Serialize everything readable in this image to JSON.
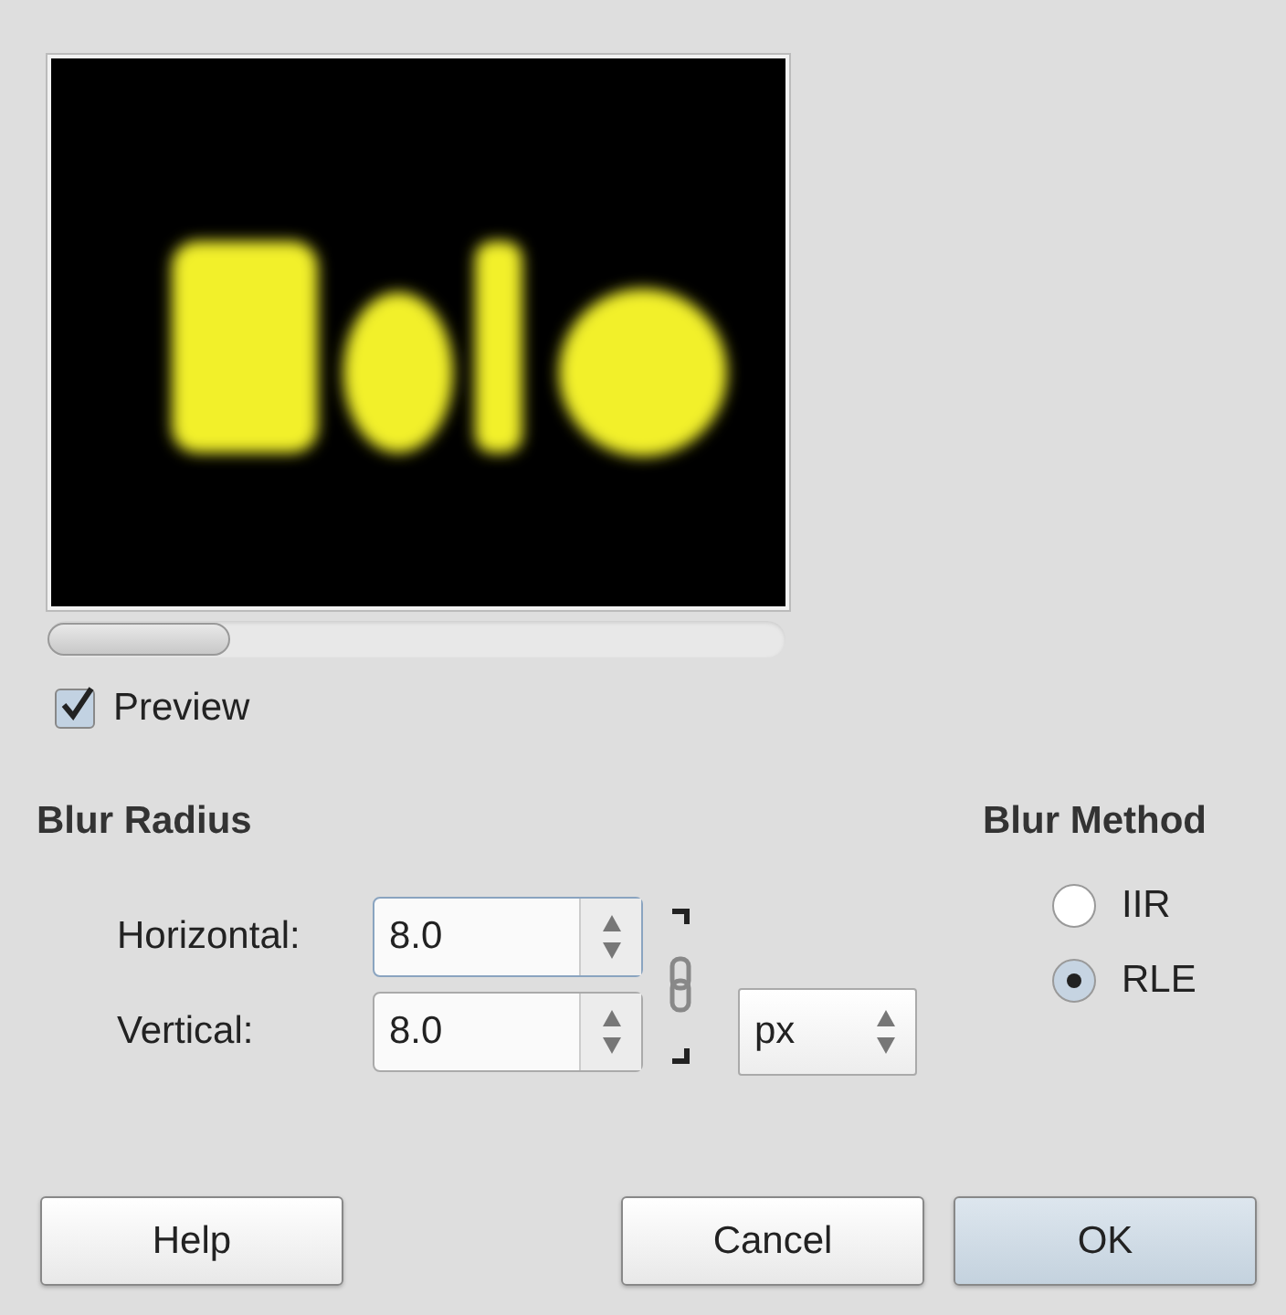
{
  "preview_toggle": {
    "label": "Preview",
    "checked": true
  },
  "blur_radius": {
    "title": "Blur Radius",
    "fields": [
      {
        "label": "Horizontal:",
        "value": "8.0",
        "focused": true
      },
      {
        "label": "Vertical:",
        "value": "8.0",
        "focused": false
      }
    ],
    "chain_linked": true,
    "unit": "px"
  },
  "blur_method": {
    "title": "Blur Method",
    "options": [
      {
        "label": "IIR",
        "selected": false
      },
      {
        "label": "RLE",
        "selected": true
      }
    ]
  },
  "buttons": [
    {
      "label": "Help",
      "default": false
    },
    {
      "label": "Cancel",
      "default": false
    },
    {
      "label": "OK",
      "default": true
    }
  ]
}
